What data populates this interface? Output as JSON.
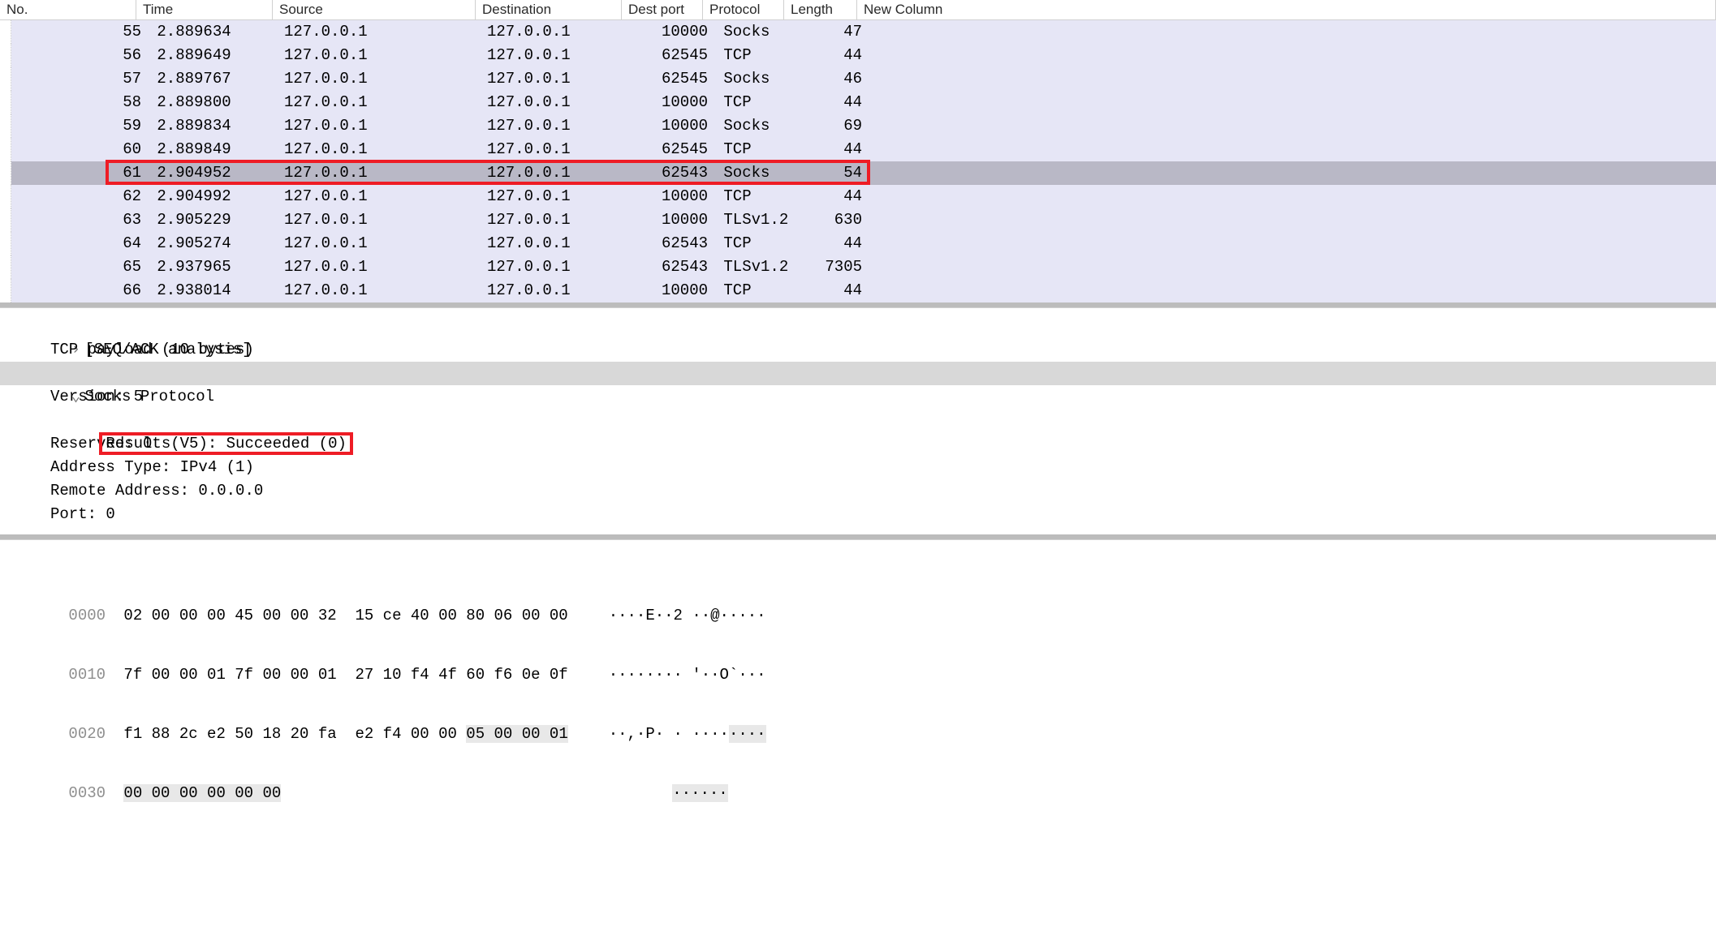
{
  "columns": {
    "no": "No.",
    "time": "Time",
    "source": "Source",
    "destination": "Destination",
    "dest_port": "Dest port",
    "protocol": "Protocol",
    "length": "Length",
    "new_column": "New Column"
  },
  "packets": [
    {
      "no": "55",
      "time": "2.889634",
      "src": "127.0.0.1",
      "dst": "127.0.0.1",
      "dport": "10000",
      "proto": "Socks",
      "len": "47",
      "selected": false
    },
    {
      "no": "56",
      "time": "2.889649",
      "src": "127.0.0.1",
      "dst": "127.0.0.1",
      "dport": "62545",
      "proto": "TCP",
      "len": "44",
      "selected": false
    },
    {
      "no": "57",
      "time": "2.889767",
      "src": "127.0.0.1",
      "dst": "127.0.0.1",
      "dport": "62545",
      "proto": "Socks",
      "len": "46",
      "selected": false
    },
    {
      "no": "58",
      "time": "2.889800",
      "src": "127.0.0.1",
      "dst": "127.0.0.1",
      "dport": "10000",
      "proto": "TCP",
      "len": "44",
      "selected": false
    },
    {
      "no": "59",
      "time": "2.889834",
      "src": "127.0.0.1",
      "dst": "127.0.0.1",
      "dport": "10000",
      "proto": "Socks",
      "len": "69",
      "selected": false
    },
    {
      "no": "60",
      "time": "2.889849",
      "src": "127.0.0.1",
      "dst": "127.0.0.1",
      "dport": "62545",
      "proto": "TCP",
      "len": "44",
      "selected": false
    },
    {
      "no": "61",
      "time": "2.904952",
      "src": "127.0.0.1",
      "dst": "127.0.0.1",
      "dport": "62543",
      "proto": "Socks",
      "len": "54",
      "selected": true
    },
    {
      "no": "62",
      "time": "2.904992",
      "src": "127.0.0.1",
      "dst": "127.0.0.1",
      "dport": "10000",
      "proto": "TCP",
      "len": "44",
      "selected": false
    },
    {
      "no": "63",
      "time": "2.905229",
      "src": "127.0.0.1",
      "dst": "127.0.0.1",
      "dport": "10000",
      "proto": "TLSv1.2",
      "len": "630",
      "selected": false
    },
    {
      "no": "64",
      "time": "2.905274",
      "src": "127.0.0.1",
      "dst": "127.0.0.1",
      "dport": "62543",
      "proto": "TCP",
      "len": "44",
      "selected": false
    },
    {
      "no": "65",
      "time": "2.937965",
      "src": "127.0.0.1",
      "dst": "127.0.0.1",
      "dport": "62543",
      "proto": "TLSv1.2",
      "len": "7305",
      "selected": false
    },
    {
      "no": "66",
      "time": "2.938014",
      "src": "127.0.0.1",
      "dst": "127.0.0.1",
      "dport": "10000",
      "proto": "TCP",
      "len": "44",
      "selected": false
    }
  ],
  "details": {
    "seq_ack": "[SEQ/ACK analysis]",
    "tcp_payload": "TCP payload (10 bytes)",
    "socks_header": "Socks Protocol",
    "version": "Version: 5",
    "results": "Results(V5): Succeeded (0)",
    "reserved": "Reserved: 0",
    "addr_type": "Address Type: IPv4 (1)",
    "remote_addr": "Remote Address: 0.0.0.0",
    "port": "Port: 0"
  },
  "hex": {
    "r0": {
      "off": "0000",
      "h": "02 00 00 00 45 00 00 32  15 ce 40 00 80 06 00 00",
      "a": "····E··2 ··@·····"
    },
    "r1": {
      "off": "0010",
      "h": "7f 00 00 01 7f 00 00 01  27 10 f4 4f 60 f6 0e 0f",
      "a": "········ '··O`···"
    },
    "r2": {
      "off": "0020",
      "h": "f1 88 2c e2 50 18 20 fa  e2 f4 00 00 ",
      "hsel": "05 00 00 01",
      "a": "··,·P· · ····",
      "asel": "····"
    },
    "r3": {
      "off": "0030",
      "h": "",
      "hsel": "00 00 00 00 00 00",
      "a": "",
      "asel": "······"
    }
  }
}
